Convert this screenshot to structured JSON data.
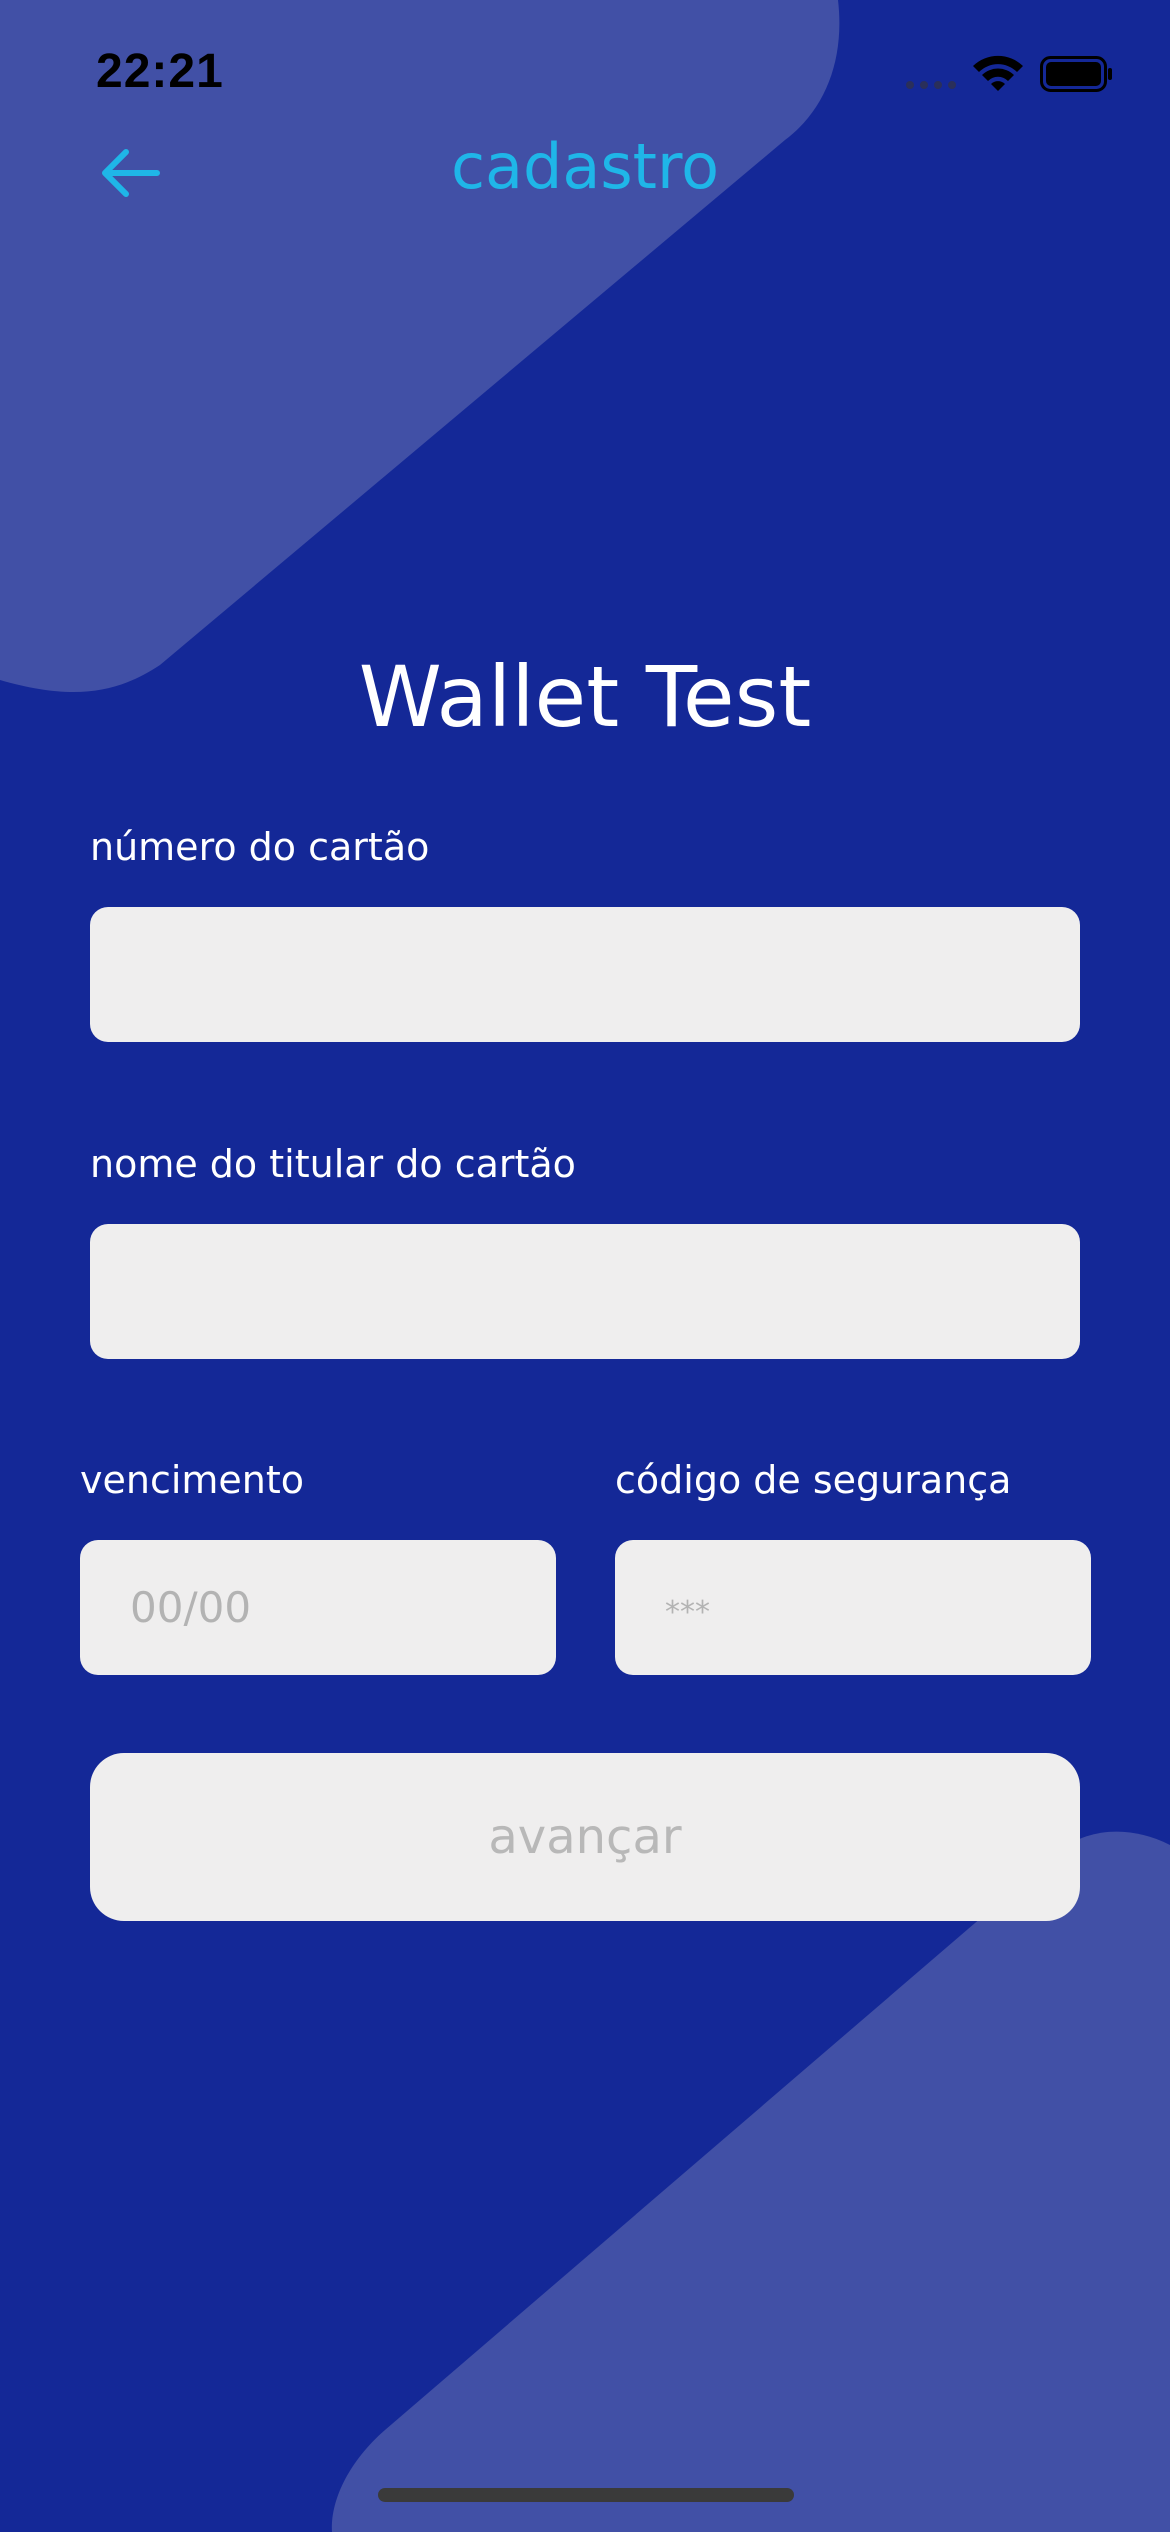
{
  "status_bar": {
    "time": "22:21"
  },
  "nav": {
    "back_icon": "arrow-left-icon",
    "title": "cadastro"
  },
  "app_title": "Wallet Test",
  "form": {
    "card_number": {
      "label": "número do cartão",
      "value": "",
      "placeholder": ""
    },
    "holder_name": {
      "label": "nome do titular do cartão",
      "value": "",
      "placeholder": ""
    },
    "expiry": {
      "label": "vencimento",
      "value": "",
      "placeholder": "00/00"
    },
    "security_code": {
      "label": "código de segurança",
      "value": "",
      "placeholder": "***"
    },
    "submit_label": "avançar"
  },
  "colors": {
    "background": "#142897",
    "decorative_shape": "#4150a6",
    "accent": "#1fb6e8",
    "input_background": "#efeeee",
    "placeholder_text": "#b3b3b3",
    "text_light": "#ffffff"
  }
}
